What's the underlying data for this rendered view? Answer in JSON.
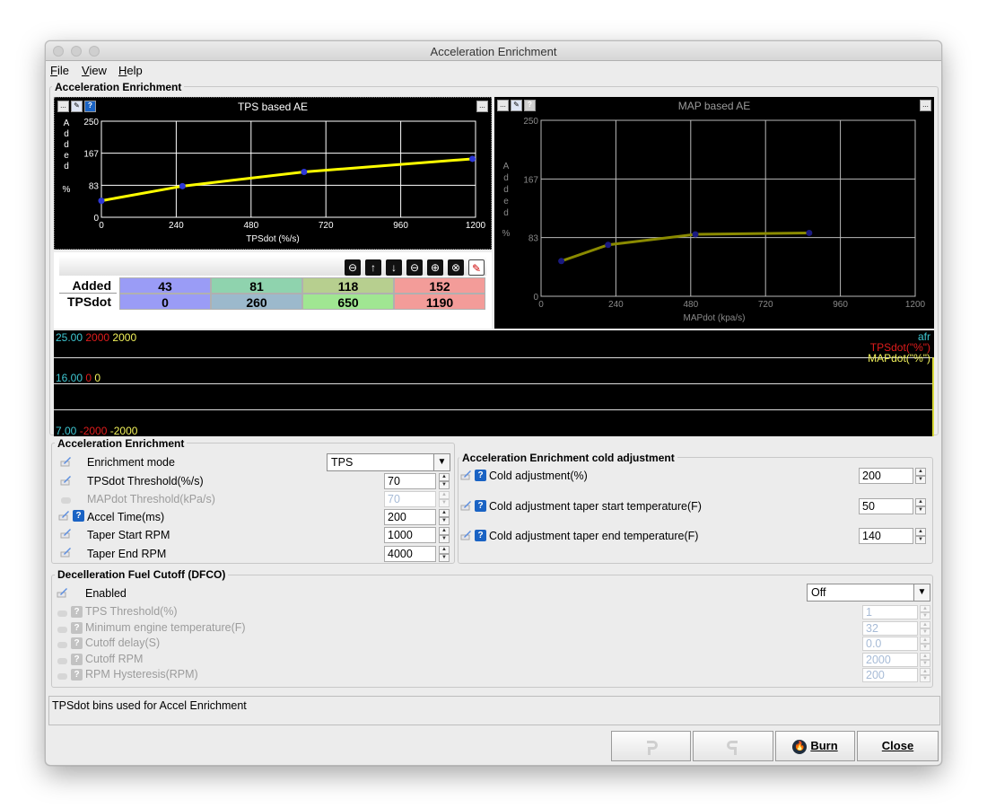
{
  "window": {
    "title": "Acceleration Enrichment"
  },
  "menu": {
    "file": "File",
    "view": "View",
    "help": "Help"
  },
  "top_group": {
    "title": "Acceleration Enrichment"
  },
  "tps_chart": {
    "title": "TPS based AE",
    "ylabel_letters": [
      "A",
      "d",
      "d",
      "e",
      "d",
      "%"
    ],
    "xlabel": "TPSdot (%/s)",
    "y_ticks": [
      "250",
      "167",
      "83",
      "0"
    ],
    "x_ticks": [
      "0",
      "240",
      "480",
      "720",
      "960",
      "1200"
    ]
  },
  "map_chart": {
    "title": "MAP based AE",
    "ylabel_letters": [
      "A",
      "d",
      "d",
      "e",
      "d",
      "%"
    ],
    "xlabel": "MAPdot (kpa/s)",
    "y_ticks": [
      "250",
      "167",
      "83",
      "0"
    ],
    "x_ticks": [
      "0",
      "240",
      "480",
      "720",
      "960",
      "1200"
    ]
  },
  "chart_data": [
    {
      "type": "line",
      "title": "TPS based AE",
      "xlabel": "TPSdot (%/s)",
      "ylabel": "Added %",
      "xlim": [
        0,
        1200
      ],
      "ylim": [
        0,
        250
      ],
      "x": [
        0,
        260,
        650,
        1190
      ],
      "series": [
        {
          "name": "Added",
          "values": [
            43,
            81,
            118,
            152
          ]
        }
      ],
      "color": "#ffff00",
      "grid": true
    },
    {
      "type": "line",
      "title": "MAP based AE",
      "xlabel": "MAPdot (kpa/s)",
      "ylabel": "Added %",
      "xlim": [
        0,
        1200
      ],
      "ylim": [
        0,
        250
      ],
      "x": [
        65,
        215,
        495,
        860
      ],
      "series": [
        {
          "name": "Added",
          "values": [
            50,
            73,
            88,
            90
          ]
        }
      ],
      "color": "#8a8a00",
      "grid": true
    }
  ],
  "table": {
    "row1_label": "Added",
    "row2_label": "TPSdot",
    "added": [
      "43",
      "81",
      "118",
      "152"
    ],
    "tpsdot": [
      "0",
      "260",
      "650",
      "1190"
    ],
    "colors": [
      "#9a9cf6",
      "#8fd3ae",
      "#b7cf8f",
      "#f39c99"
    ],
    "colors2": [
      "#9a9cf6",
      "#9cb9cc",
      "#a0e692",
      "#f39c99"
    ]
  },
  "toolbar_icons": [
    "minus-circle-icon",
    "up-arrow-icon",
    "down-arrow-icon",
    "minus-circle-icon",
    "plus-circle-icon",
    "close-circle-icon",
    "pen-icon"
  ],
  "gauge": {
    "row1": {
      "afr": "25.00",
      "tps": "2000",
      "map": "2000"
    },
    "row2": {
      "afr": "16.00",
      "tps": "0",
      "map": "0"
    },
    "row3": {
      "afr": "7.00",
      "tps": "-2000",
      "map": "-2000"
    },
    "legend": {
      "afr": "afr",
      "tps": "TPSdot(\"%\")",
      "map": "MAPdot(\"%\")"
    }
  },
  "ae_settings": {
    "title": "Acceleration Enrichment",
    "enrichment_mode_label": "Enrichment mode",
    "enrichment_mode_value": "TPS",
    "tpsdot_threshold_label": "TPSdot Threshold(%/s)",
    "tpsdot_threshold_value": "70",
    "mapdot_threshold_label": "MAPdot Threshold(kPa/s)",
    "mapdot_threshold_value": "70",
    "accel_time_label": "Accel Time(ms)",
    "accel_time_value": "200",
    "taper_start_label": "Taper Start RPM",
    "taper_start_value": "1000",
    "taper_end_label": "Taper End RPM",
    "taper_end_value": "4000"
  },
  "cold_adj": {
    "title": "Acceleration Enrichment cold adjustment",
    "cold_adjustment_label": "Cold adjustment(%)",
    "cold_adjustment_value": "200",
    "taper_start_label": "Cold adjustment taper start temperature(F)",
    "taper_start_value": "50",
    "taper_end_label": "Cold adjustment taper end temperature(F)",
    "taper_end_value": "140"
  },
  "dfco": {
    "title": "Decelleration Fuel Cutoff (DFCO)",
    "enabled_label": "Enabled",
    "enabled_value": "Off",
    "tps_threshold_label": "TPS Threshold(%)",
    "tps_threshold_value": "1",
    "min_temp_label": "Minimum engine temperature(F)",
    "min_temp_value": "32",
    "cutoff_delay_label": "Cutoff delay(S)",
    "cutoff_delay_value": "0.0",
    "cutoff_rpm_label": "Cutoff RPM",
    "cutoff_rpm_value": "2000",
    "rpm_hyst_label": "RPM Hysteresis(RPM)",
    "rpm_hyst_value": "200"
  },
  "status": {
    "text": "TPSdot bins used for Accel Enrichment"
  },
  "buttons": {
    "burn": "Burn",
    "close": "Close"
  }
}
